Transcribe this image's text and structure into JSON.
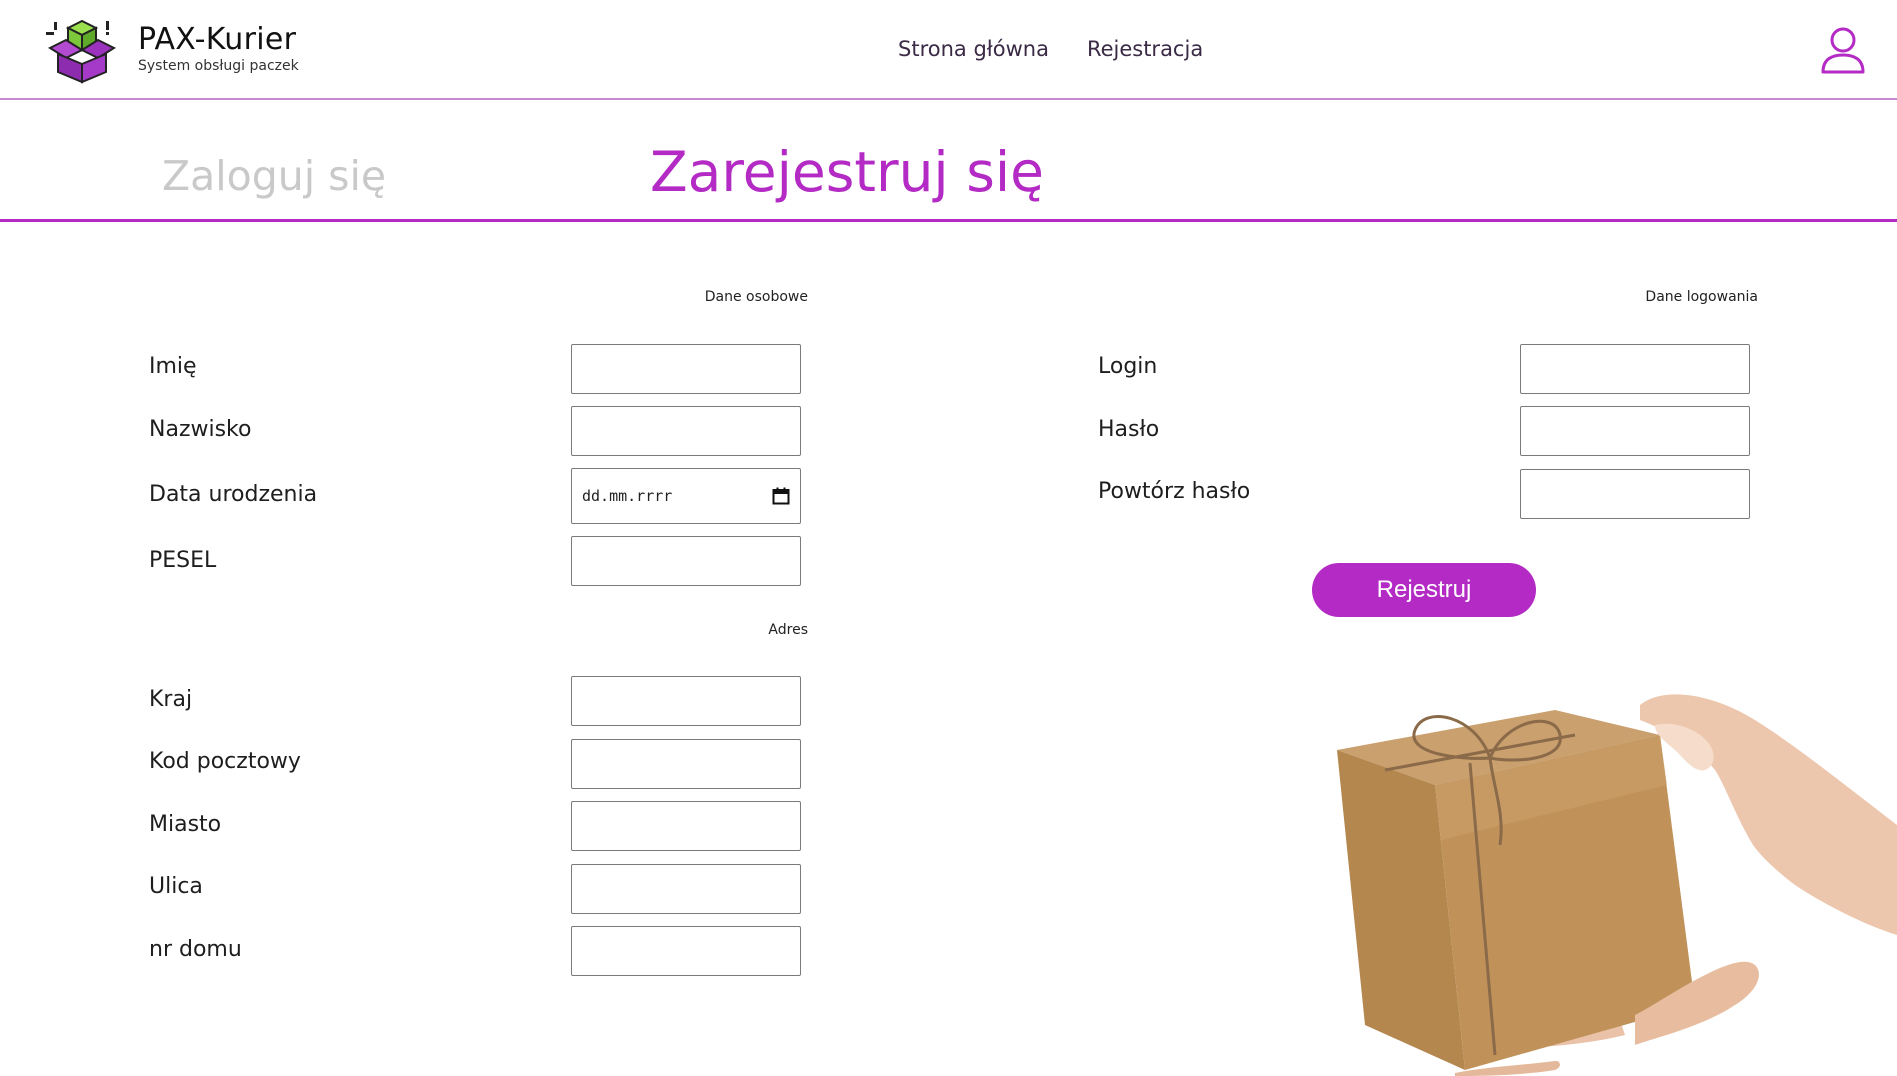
{
  "header": {
    "brand_title": "PAX-Kurier",
    "brand_subtitle": "System obsługi paczek",
    "nav": [
      {
        "label": "Strona główna"
      },
      {
        "label": "Rejestracja"
      }
    ]
  },
  "tabs": {
    "login": "Zaloguj się",
    "register": "Zarejestruj się"
  },
  "personal": {
    "heading": "Dane osobowe",
    "fields": [
      {
        "label": "Imię",
        "value": ""
      },
      {
        "label": "Nazwisko",
        "value": ""
      },
      {
        "label": "Data urodzenia",
        "placeholder": "dd.mm.rrrr"
      },
      {
        "label": "PESEL",
        "value": ""
      }
    ]
  },
  "address": {
    "heading": "Adres",
    "fields": [
      {
        "label": "Kraj",
        "value": ""
      },
      {
        "label": "Kod pocztowy",
        "value": ""
      },
      {
        "label": "Miasto",
        "value": ""
      },
      {
        "label": "Ulica",
        "value": ""
      },
      {
        "label": "nr domu",
        "value": ""
      }
    ]
  },
  "login_data": {
    "heading": "Dane logowania",
    "fields": [
      {
        "label": "Login",
        "value": ""
      },
      {
        "label": "Hasło",
        "value": ""
      },
      {
        "label": "Powtórz hasło",
        "value": ""
      }
    ],
    "submit_label": "Rejestruj"
  },
  "colors": {
    "accent": "#b32bc4",
    "header_border": "#c38ad0",
    "inactive_tab": "#c9c9c9"
  },
  "icons": {
    "logo": "package-box-icon",
    "user": "user-account-icon",
    "date": "calendar-icon"
  }
}
